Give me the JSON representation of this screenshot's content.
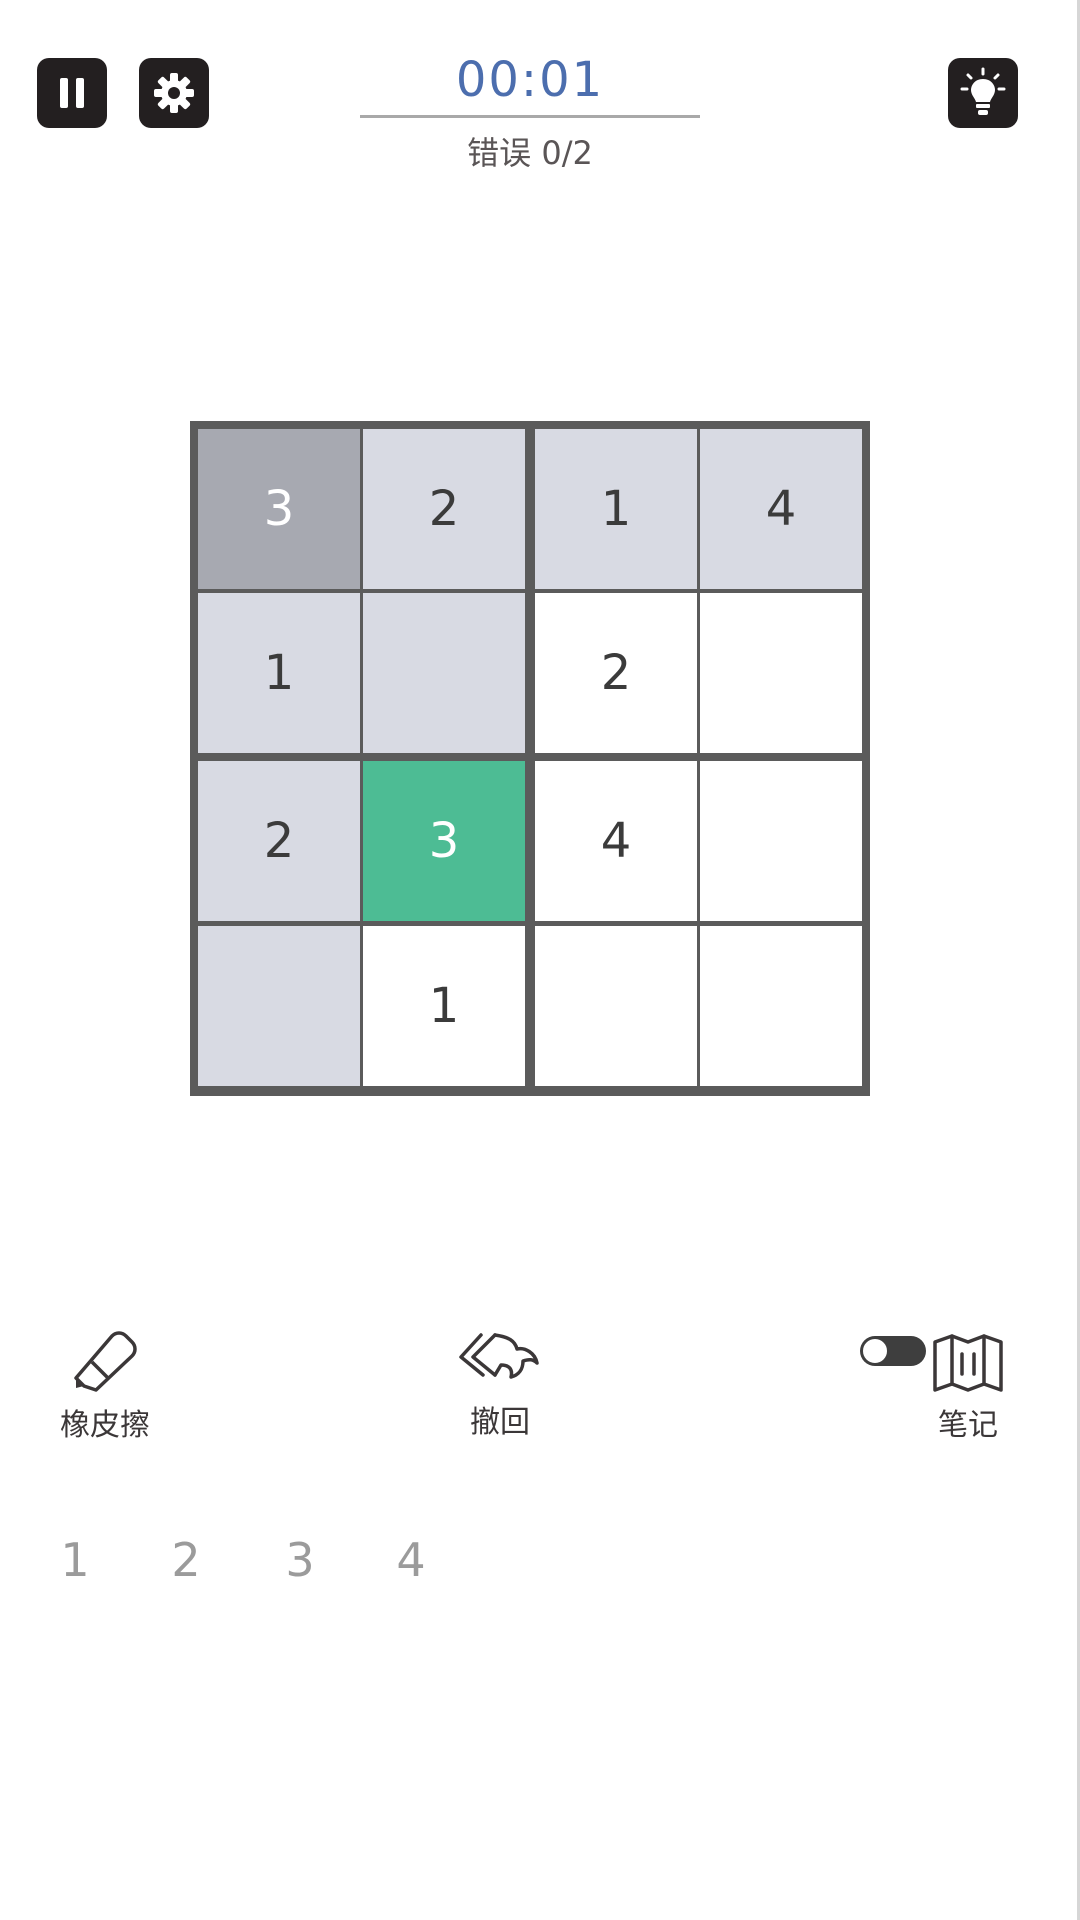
{
  "header": {
    "timer": "00:01",
    "mistakes": "错误 0/2"
  },
  "icons": {
    "pause": "pause-icon",
    "settings": "gear-icon",
    "hint": "lightbulb-icon",
    "eraser": "eraser-icon",
    "undo": "undo-icon",
    "notes": "notebook-icon"
  },
  "board": {
    "size": 4,
    "cells": [
      [
        {
          "value": "3",
          "state": "selected"
        },
        {
          "value": "2",
          "state": "given"
        },
        {
          "value": "1",
          "state": "given"
        },
        {
          "value": "4",
          "state": "given"
        }
      ],
      [
        {
          "value": "1",
          "state": "given"
        },
        {
          "value": "",
          "state": "given"
        },
        {
          "value": "2",
          "state": "empty"
        },
        {
          "value": "",
          "state": "empty"
        }
      ],
      [
        {
          "value": "2",
          "state": "given"
        },
        {
          "value": "3",
          "state": "highlight"
        },
        {
          "value": "4",
          "state": "empty"
        },
        {
          "value": "",
          "state": "empty"
        }
      ],
      [
        {
          "value": "",
          "state": "given"
        },
        {
          "value": "1",
          "state": "empty"
        },
        {
          "value": "",
          "state": "empty"
        },
        {
          "value": "",
          "state": "empty"
        }
      ]
    ]
  },
  "tools": {
    "eraser_label": "橡皮擦",
    "undo_label": "撤回",
    "notes_label": "笔记",
    "notes_enabled": false
  },
  "numpad": {
    "keys": [
      "1",
      "2",
      "3",
      "4"
    ]
  },
  "colors": {
    "timer": "#4c6eae",
    "highlight": "#4dbc94",
    "selected": "#a7a9b1",
    "given": "#d8dae3",
    "board_border": "#5b5b5b"
  }
}
